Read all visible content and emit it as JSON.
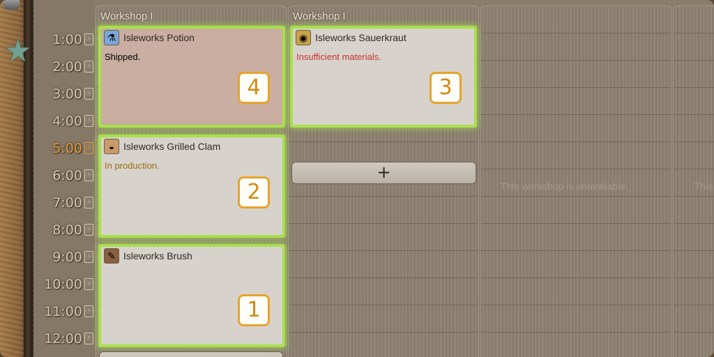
{
  "left": {
    "star_icon": "star-icon",
    "times": [
      {
        "label": "1:00",
        "icon": "ⓐ",
        "active": false
      },
      {
        "label": "2:00",
        "icon": "ⓐ",
        "active": false
      },
      {
        "label": "3:00",
        "icon": "ⓐ",
        "active": false
      },
      {
        "label": "4:00",
        "icon": "ⓐ",
        "active": false
      },
      {
        "label": "5:00",
        "icon": "ⓐ",
        "active": true
      },
      {
        "label": "6:00",
        "icon": "ⓐ",
        "active": false
      },
      {
        "label": "7:00",
        "icon": "ⓐ",
        "active": false
      },
      {
        "label": "8:00",
        "icon": "ⓐ",
        "active": false
      },
      {
        "label": "9:00",
        "icon": "ⓐ",
        "active": false
      },
      {
        "label": "10:00",
        "icon": "ⓐ",
        "active": false
      },
      {
        "label": "11:00",
        "icon": "ⓐ",
        "active": false
      },
      {
        "label": "12:00",
        "icon": "ⓟ",
        "active": false
      }
    ]
  },
  "workshops": [
    {
      "header": "Workshop I",
      "cards": [
        {
          "title": "Isleworks Potion",
          "status": "Shipped.",
          "status_color": "#2e2822",
          "badge": "4",
          "icon": "potion-icon",
          "glyph": "⚗",
          "shipped": true
        },
        {
          "title": "Isleworks Grilled Clam",
          "status": "In production.",
          "status_color": "#9a6a10",
          "badge": "2",
          "icon": "clam-icon",
          "glyph": "◒",
          "shipped": false
        },
        {
          "title": "Isleworks Brush",
          "status": "",
          "status_color": "#2e2822",
          "badge": "1",
          "icon": "brush-icon",
          "glyph": "✎",
          "shipped": false
        }
      ]
    },
    {
      "header": "Workshop I",
      "cards": [
        {
          "title": "Isleworks Sauerkraut",
          "status": "Insufficient materials.",
          "status_color": "#c8322a",
          "badge": "3",
          "icon": "sauerkraut-icon",
          "glyph": "◉",
          "shipped": false
        }
      ],
      "add_label": "+"
    },
    {
      "header": "",
      "unavailable": "This workshop is unavailable."
    },
    {
      "header": "",
      "unavailable": "This"
    }
  ],
  "colors": {
    "highlight": "#a8e04a",
    "active_time": "#e39a3c",
    "badge_border": "#e6a42a"
  }
}
